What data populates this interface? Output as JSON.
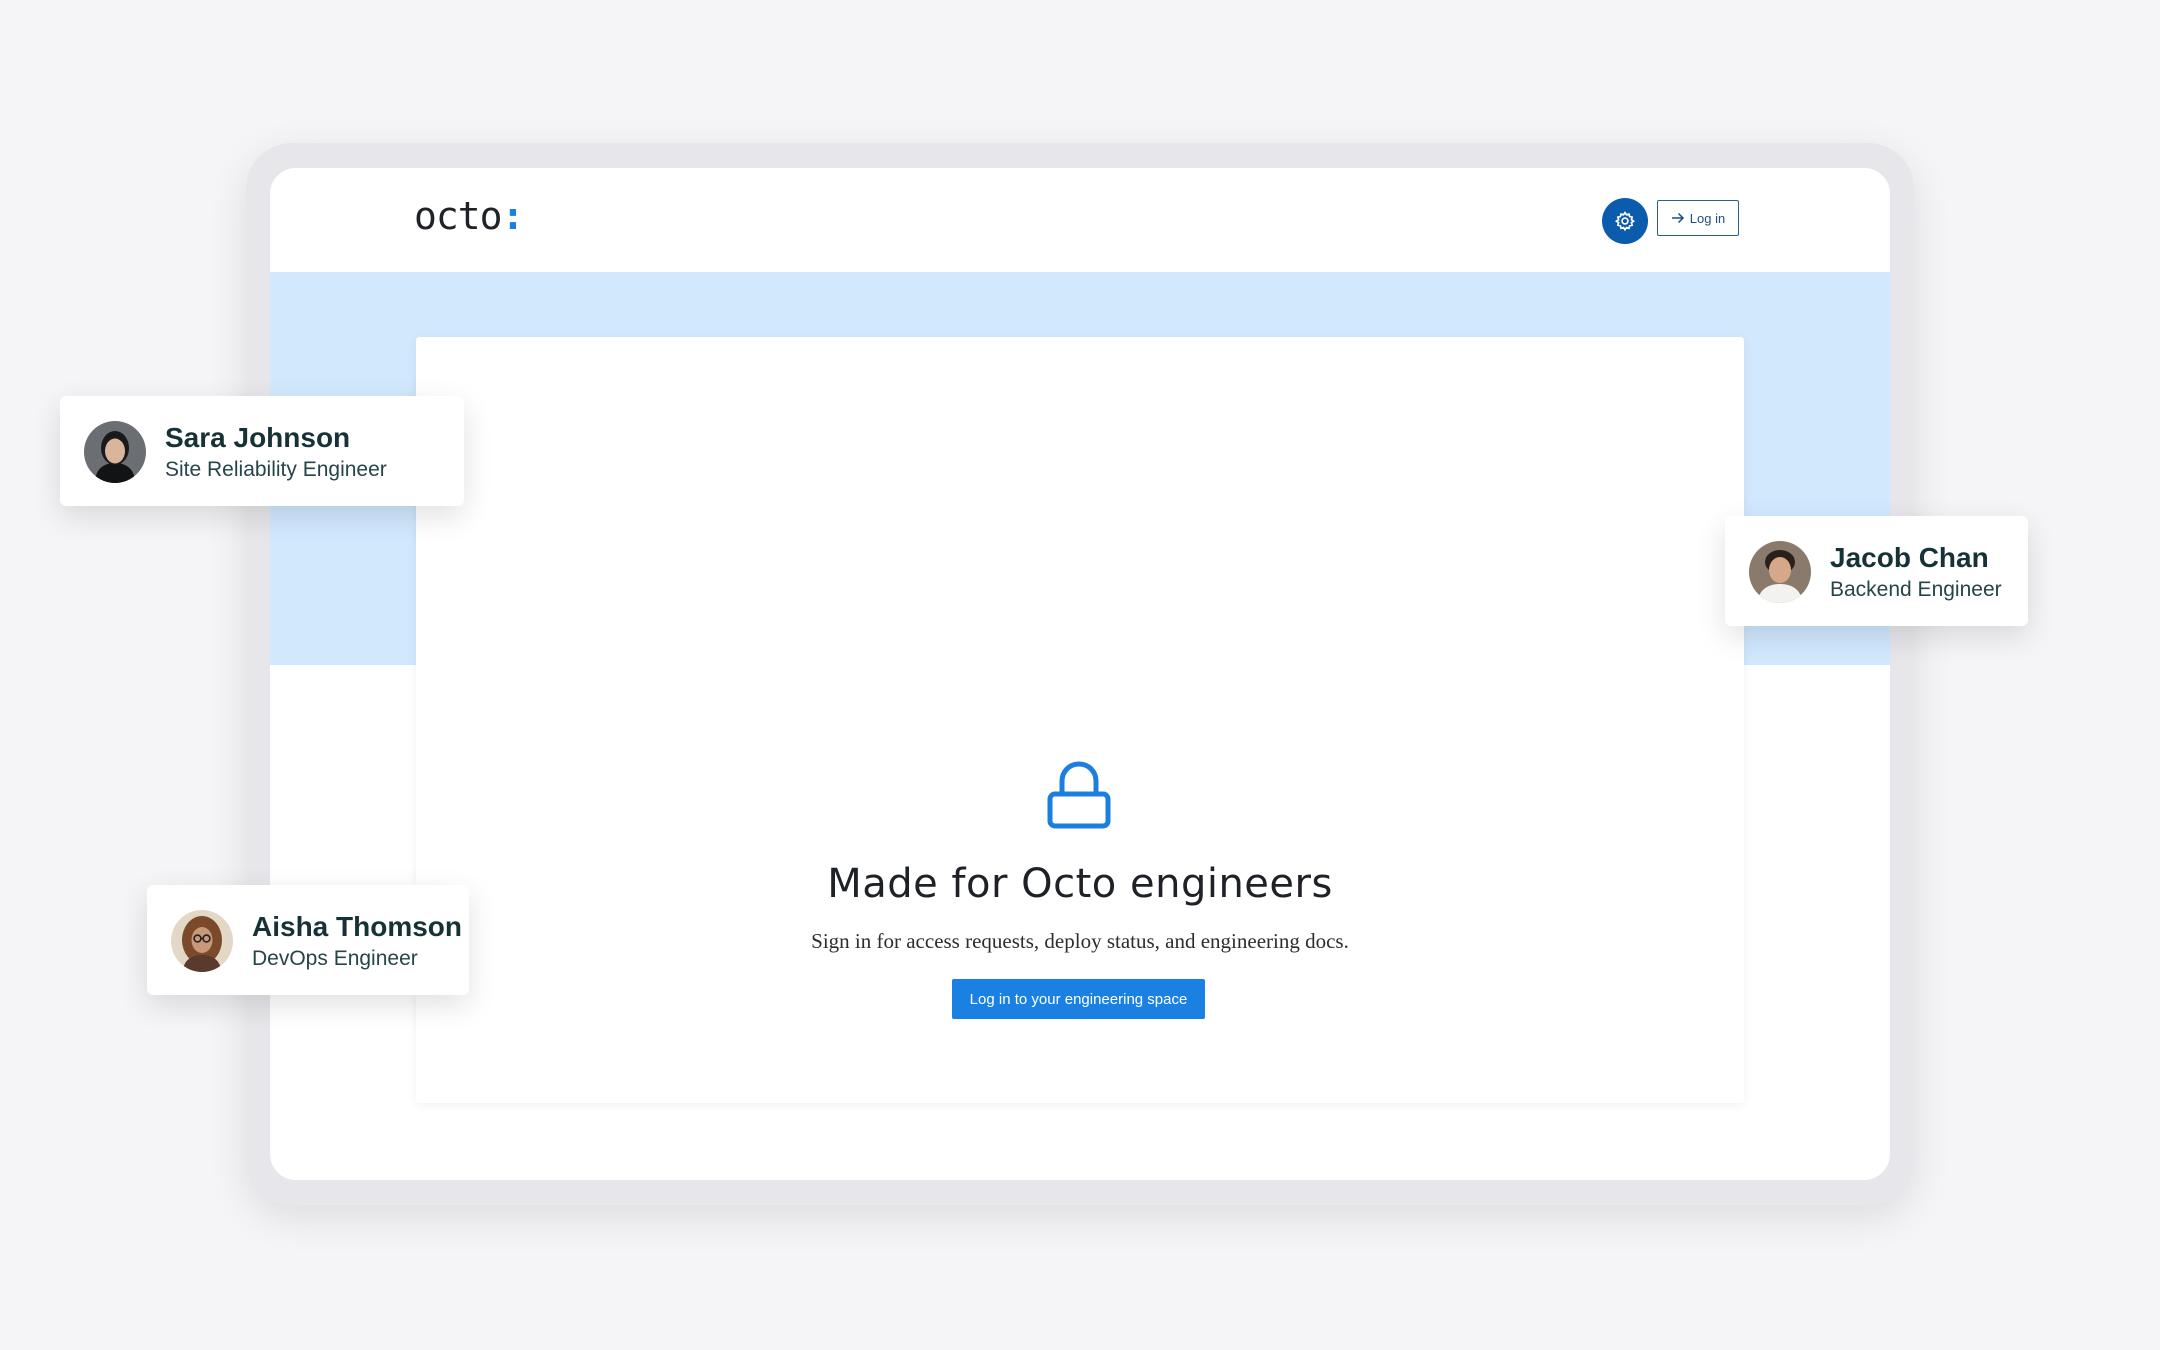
{
  "header": {
    "logo_text": "octo",
    "logo_accent": ":",
    "login_label": "Log in"
  },
  "hero": {
    "headline": "Made for Octo engineers",
    "subtext": "Sign in for access requests, deploy status, and engineering docs.",
    "cta_label": "Log in to your engineering space"
  },
  "profiles": [
    {
      "name": "Sara Johnson",
      "role": "Site Reliability Engineer"
    },
    {
      "name": "Jacob Chan",
      "role": "Backend Engineer"
    },
    {
      "name": "Aisha Thomson",
      "role": "DevOps Engineer"
    }
  ],
  "colors": {
    "accent": "#1a80e2",
    "settings_button": "#0b5cad",
    "hero_band": "#d1e8fd",
    "background": "#f5f4f7",
    "name_text": "#163237"
  },
  "icons": {
    "settings": "gear-icon",
    "login": "arrow-right-icon",
    "lock": "lock-icon"
  }
}
